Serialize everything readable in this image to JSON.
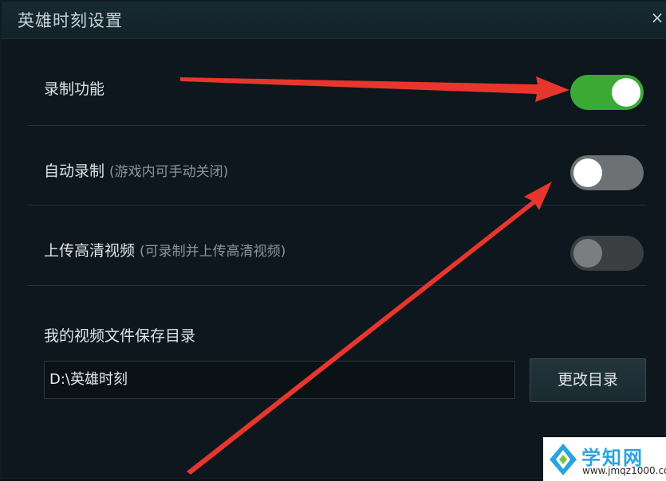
{
  "window": {
    "title": "英雄时刻设置",
    "close_glyph": "×"
  },
  "rows": [
    {
      "label": "录制功能",
      "hint": "",
      "toggle_on": true
    },
    {
      "label": "自动录制",
      "hint": "(游戏内可手动关闭)",
      "toggle_on": false
    },
    {
      "label": "上传高清视频",
      "hint": "(可录制并上传高清视频)",
      "toggle_on": false,
      "disabled": true
    }
  ],
  "directory": {
    "label": "我的视频文件保存目录",
    "value": "D:\\英雄时刻",
    "button_label": "更改目录"
  },
  "watermark": {
    "title": "学知网",
    "url": "www.jmqz1000.com"
  },
  "colors": {
    "toggle_on": "#3aaa35",
    "toggle_off": "#6d7173",
    "toggle_disabled": "#3b3f42",
    "annotation_arrow": "#e8362c",
    "watermark_text": "#2aa4e0"
  }
}
